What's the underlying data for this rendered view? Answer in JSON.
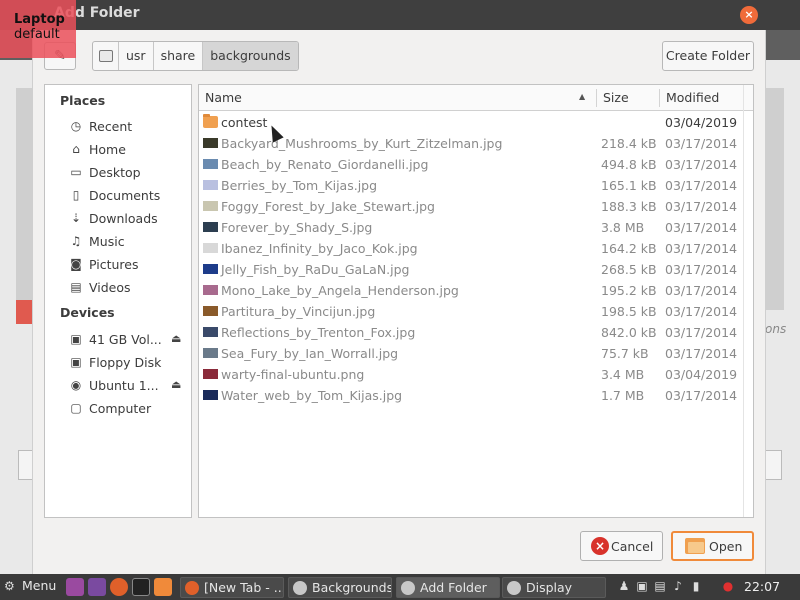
{
  "window": {
    "title": "Add Folder",
    "close_label": "×"
  },
  "overlay": {
    "line1": "Laptop",
    "line2": "default"
  },
  "background_hint": {
    "text": "ons"
  },
  "toolbar": {
    "path": [
      "usr",
      "share",
      "backgrounds"
    ],
    "create_folder_label": "Create Folder"
  },
  "sidebar": {
    "places_title": "Places",
    "places": [
      {
        "label": "Recent",
        "icon": "clock-icon"
      },
      {
        "label": "Home",
        "icon": "home-icon"
      },
      {
        "label": "Desktop",
        "icon": "desktop-icon"
      },
      {
        "label": "Documents",
        "icon": "document-icon"
      },
      {
        "label": "Downloads",
        "icon": "download-icon"
      },
      {
        "label": "Music",
        "icon": "music-icon"
      },
      {
        "label": "Pictures",
        "icon": "camera-icon"
      },
      {
        "label": "Videos",
        "icon": "film-icon"
      }
    ],
    "devices_title": "Devices",
    "devices": [
      {
        "label": "41 GB Vol...",
        "icon": "drive-icon",
        "eject": true
      },
      {
        "label": "Floppy Disk",
        "icon": "floppy-icon",
        "eject": false
      },
      {
        "label": "Ubuntu 1...",
        "icon": "disc-icon",
        "eject": true
      },
      {
        "label": "Computer",
        "icon": "computer-icon",
        "eject": false
      }
    ]
  },
  "filelist": {
    "columns": {
      "name": "Name",
      "size": "Size",
      "modified": "Modified"
    },
    "rows": [
      {
        "name": "contest",
        "size": "",
        "modified": "03/04/2019",
        "folder": true,
        "thumb": ""
      },
      {
        "name": "Backyard_Mushrooms_by_Kurt_Zitzelman.jpg",
        "size": "218.4 kB",
        "modified": "03/17/2014",
        "folder": false,
        "thumb": "#3a3a2a"
      },
      {
        "name": "Beach_by_Renato_Giordanelli.jpg",
        "size": "494.8 kB",
        "modified": "03/17/2014",
        "folder": false,
        "thumb": "#6a8bb0"
      },
      {
        "name": "Berries_by_Tom_Kijas.jpg",
        "size": "165.1 kB",
        "modified": "03/17/2014",
        "folder": false,
        "thumb": "#b9c0e0"
      },
      {
        "name": "Foggy_Forest_by_Jake_Stewart.jpg",
        "size": "188.3 kB",
        "modified": "03/17/2014",
        "folder": false,
        "thumb": "#c9c6b0"
      },
      {
        "name": "Forever_by_Shady_S.jpg",
        "size": "3.8 MB",
        "modified": "03/17/2014",
        "folder": false,
        "thumb": "#2c3e50"
      },
      {
        "name": "Ibanez_Infinity_by_Jaco_Kok.jpg",
        "size": "164.2 kB",
        "modified": "03/17/2014",
        "folder": false,
        "thumb": "#d8d8d8"
      },
      {
        "name": "Jelly_Fish_by_RaDu_GaLaN.jpg",
        "size": "268.5 kB",
        "modified": "03/17/2014",
        "folder": false,
        "thumb": "#1d3c8a"
      },
      {
        "name": "Mono_Lake_by_Angela_Henderson.jpg",
        "size": "195.2 kB",
        "modified": "03/17/2014",
        "folder": false,
        "thumb": "#a86a8e"
      },
      {
        "name": "Partitura_by_Vincijun.jpg",
        "size": "198.5 kB",
        "modified": "03/17/2014",
        "folder": false,
        "thumb": "#8a5a2a"
      },
      {
        "name": "Reflections_by_Trenton_Fox.jpg",
        "size": "842.0 kB",
        "modified": "03/17/2014",
        "folder": false,
        "thumb": "#3a4a6a"
      },
      {
        "name": "Sea_Fury_by_Ian_Worrall.jpg",
        "size": "75.7 kB",
        "modified": "03/17/2014",
        "folder": false,
        "thumb": "#6a7a8a"
      },
      {
        "name": "warty-final-ubuntu.png",
        "size": "3.4 MB",
        "modified": "03/04/2019",
        "folder": false,
        "thumb": "#8a2a3a"
      },
      {
        "name": "Water_web_by_Tom_Kijas.jpg",
        "size": "1.7 MB",
        "modified": "03/17/2014",
        "folder": false,
        "thumb": "#1a2a5a"
      }
    ]
  },
  "buttons": {
    "cancel": "Cancel",
    "open": "Open"
  },
  "taskbar": {
    "menu_label": "Menu",
    "tasks": [
      {
        "label": "[New Tab - ...",
        "active": false
      },
      {
        "label": "Backgrounds",
        "active": false
      },
      {
        "label": "Add Folder",
        "active": true
      },
      {
        "label": "Display",
        "active": false
      }
    ],
    "clock": "22:07"
  },
  "colors": {
    "accent": "#f08a3a",
    "titlebar": "#3f3f3f",
    "close": "#f06b3a",
    "cancel_icon": "#d8322b"
  }
}
